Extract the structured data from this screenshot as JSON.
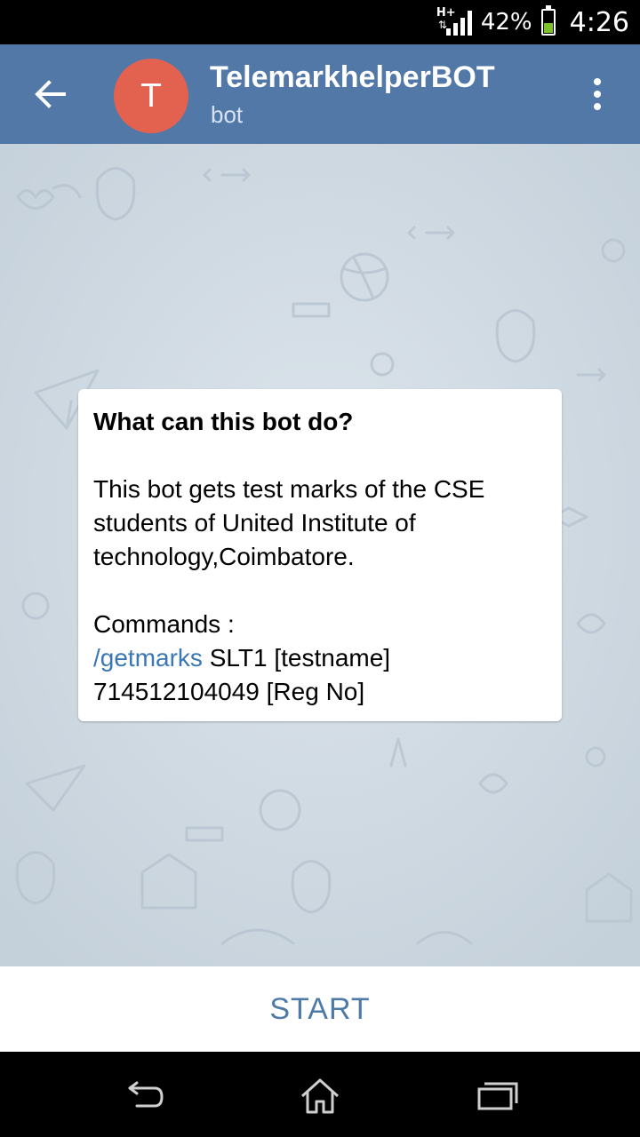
{
  "status_bar": {
    "network_type": "H+",
    "battery_percent": "42%",
    "battery_level": 0.42,
    "time": "4:26",
    "battery_color": "#7ec22b"
  },
  "header": {
    "avatar_letter": "T",
    "title": "TelemarkhelperBOT",
    "subtitle": "bot",
    "background_color": "#5278a8",
    "avatar_color": "#e3614f",
    "back_icon": "arrow-left-icon",
    "menu_icon": "more-vertical-icon"
  },
  "info_card": {
    "heading": "What can this bot do?",
    "description": "This bot gets test marks of the CSE students of United Institute of technology,Coimbatore.",
    "commands_label": "Commands :",
    "command_link": "/getmarks",
    "command_args": " SLT1 [testname]",
    "command_example": "714512104049 [Reg No]",
    "link_color": "#3a77b3"
  },
  "start_button": {
    "label": "START",
    "color": "#4e7aa8"
  },
  "nav_bar": {
    "back_icon": "nav-back-icon",
    "home_icon": "nav-home-icon",
    "recents_icon": "nav-recents-icon"
  }
}
